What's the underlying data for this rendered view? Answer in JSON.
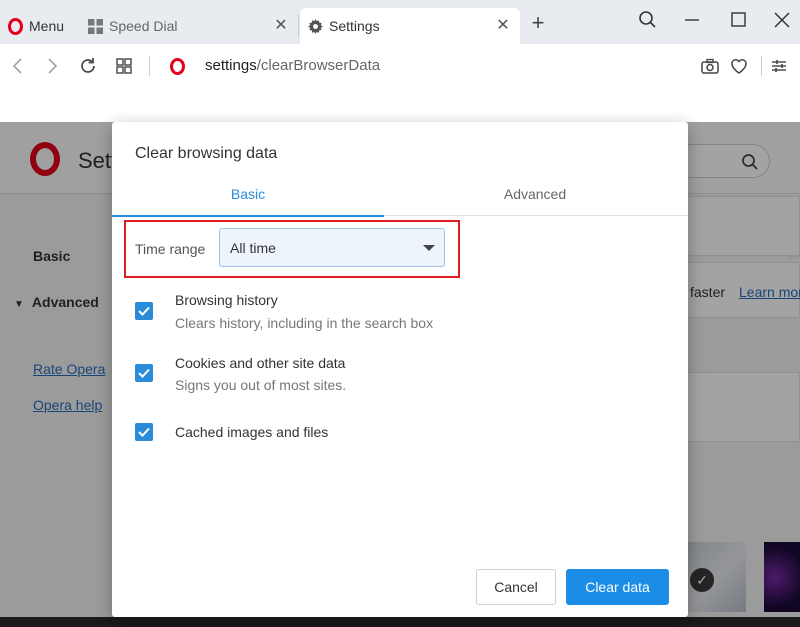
{
  "tabs": {
    "menu_label": "Menu",
    "speed_dial_label": "Speed Dial",
    "settings_label": "Settings"
  },
  "addressbar": {
    "url_host": "settings",
    "url_path": "/clearBrowserData"
  },
  "background_page": {
    "title": "Setti",
    "sidebar": {
      "basic": "Basic",
      "advanced": "Advanced",
      "rate_opera": "Rate Opera",
      "opera_help": "Opera help"
    },
    "card_text": "faster",
    "card_link": "Learn more"
  },
  "dialog": {
    "title": "Clear browsing data",
    "tabs": [
      {
        "label": "Basic",
        "active": true
      },
      {
        "label": "Advanced",
        "active": false
      }
    ],
    "time_range": {
      "label": "Time range",
      "selected": "All time"
    },
    "options": [
      {
        "title": "Browsing history",
        "description": "Clears history, including in the search box",
        "checked": true
      },
      {
        "title": "Cookies and other site data",
        "description": "Signs you out of most sites.",
        "checked": true
      },
      {
        "title": "Cached images and files",
        "description": "",
        "checked": true
      }
    ],
    "cancel_label": "Cancel",
    "clear_label": "Clear data"
  },
  "colors": {
    "accent": "#2a8bd8",
    "primary_button": "#1b8de6",
    "highlight_box": "#e01b24",
    "opera_red": "#e2001a"
  }
}
